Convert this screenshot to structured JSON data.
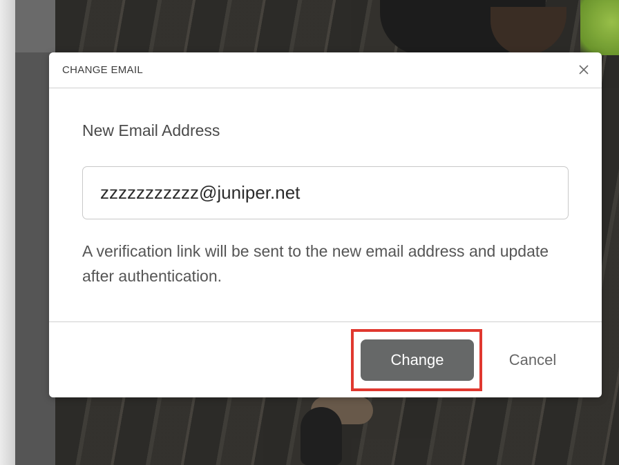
{
  "dialog": {
    "title": "CHANGE EMAIL",
    "close_icon": "close-icon",
    "field_label": "New Email Address",
    "email_value": "zzzzzzzzzzz@juniper.net",
    "help_text": "A verification link will be sent to the new email address and update after authentication.",
    "buttons": {
      "change_label": "Change",
      "cancel_label": "Cancel"
    }
  },
  "colors": {
    "primary_button": "#666868",
    "highlight": "#e0382f",
    "text": "#4a4a4a"
  }
}
